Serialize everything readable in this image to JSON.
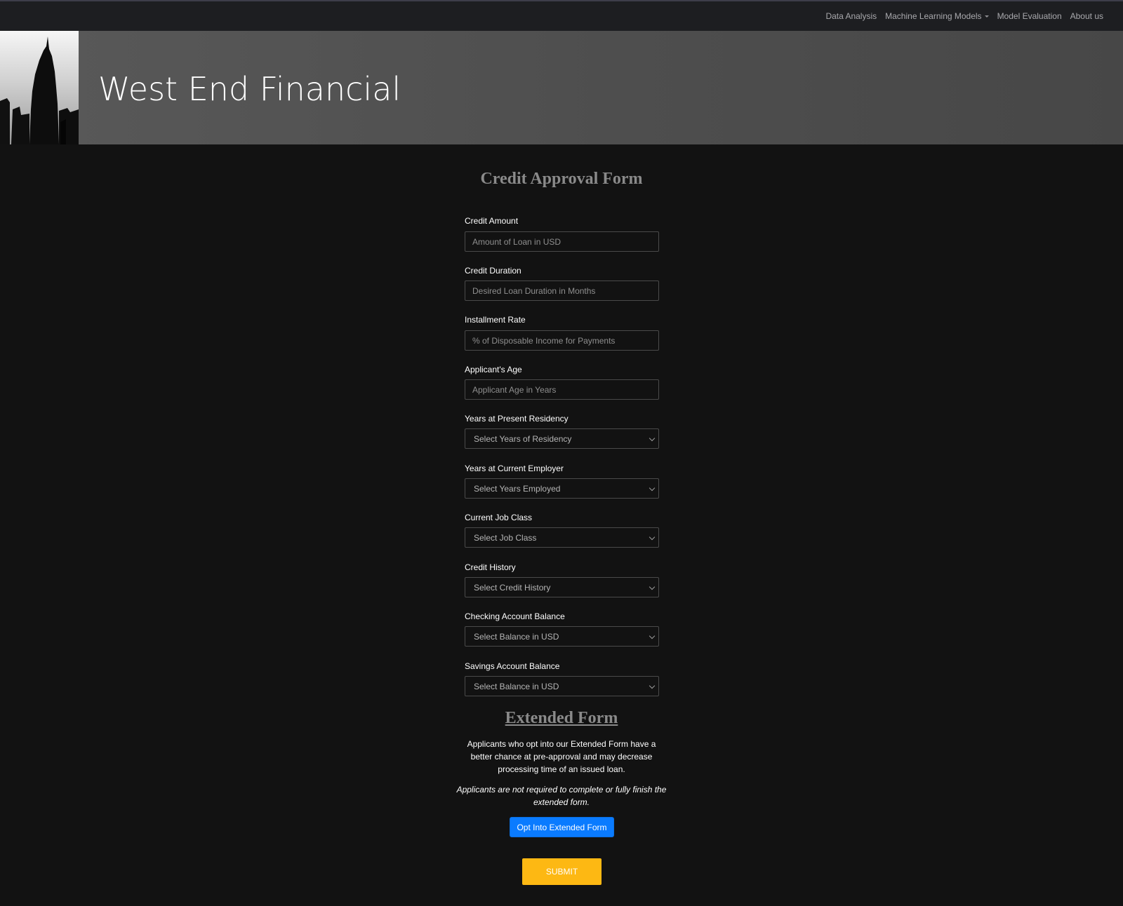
{
  "nav": {
    "links": [
      {
        "label": "Data Analysis"
      },
      {
        "label": "Machine Learning Models",
        "has_dropdown": true
      },
      {
        "label": "Model Evaluation"
      },
      {
        "label": "About us"
      }
    ]
  },
  "banner": {
    "title": "West End Financial"
  },
  "form": {
    "title": "Credit Approval Form",
    "fields": [
      {
        "label": "Credit Amount",
        "type": "input",
        "placeholder": "Amount of Loan in USD"
      },
      {
        "label": "Credit Duration",
        "type": "input",
        "placeholder": "Desired Loan Duration in Months"
      },
      {
        "label": "Installment Rate",
        "type": "input",
        "placeholder": "% of Disposable Income for Payments"
      },
      {
        "label": "Applicant's Age",
        "type": "input",
        "placeholder": "Applicant Age in Years"
      },
      {
        "label": "Years at Present Residency",
        "type": "select",
        "selected": "Select Years of Residency"
      },
      {
        "label": "Years at Current Employer",
        "type": "select",
        "selected": "Select Years Employed"
      },
      {
        "label": "Current Job Class",
        "type": "select",
        "selected": "Select Job Class"
      },
      {
        "label": "Credit History",
        "type": "select",
        "selected": "Select Credit History"
      },
      {
        "label": "Checking Account Balance",
        "type": "select",
        "selected": "Select Balance in USD"
      },
      {
        "label": "Savings Account Balance",
        "type": "select",
        "selected": "Select Balance in USD"
      }
    ]
  },
  "extended": {
    "title": "Extended Form",
    "description": "Applicants who opt into our Extended Form have a better chance at pre-approval and may decrease processing time of an issued loan.",
    "note": "Applicants are not required to complete or fully finish the extended form.",
    "opt_in_label": "Opt Into Extended Form"
  },
  "submit_label": "SUBMIT",
  "colors": {
    "page_bg": "#121212",
    "navbar_bg": "#1d1e21",
    "banner_bg": "#4e4e4e",
    "title_gray": "#8a8a8a",
    "primary_blue": "#0a7bff",
    "submit_yellow": "#fdb813"
  }
}
